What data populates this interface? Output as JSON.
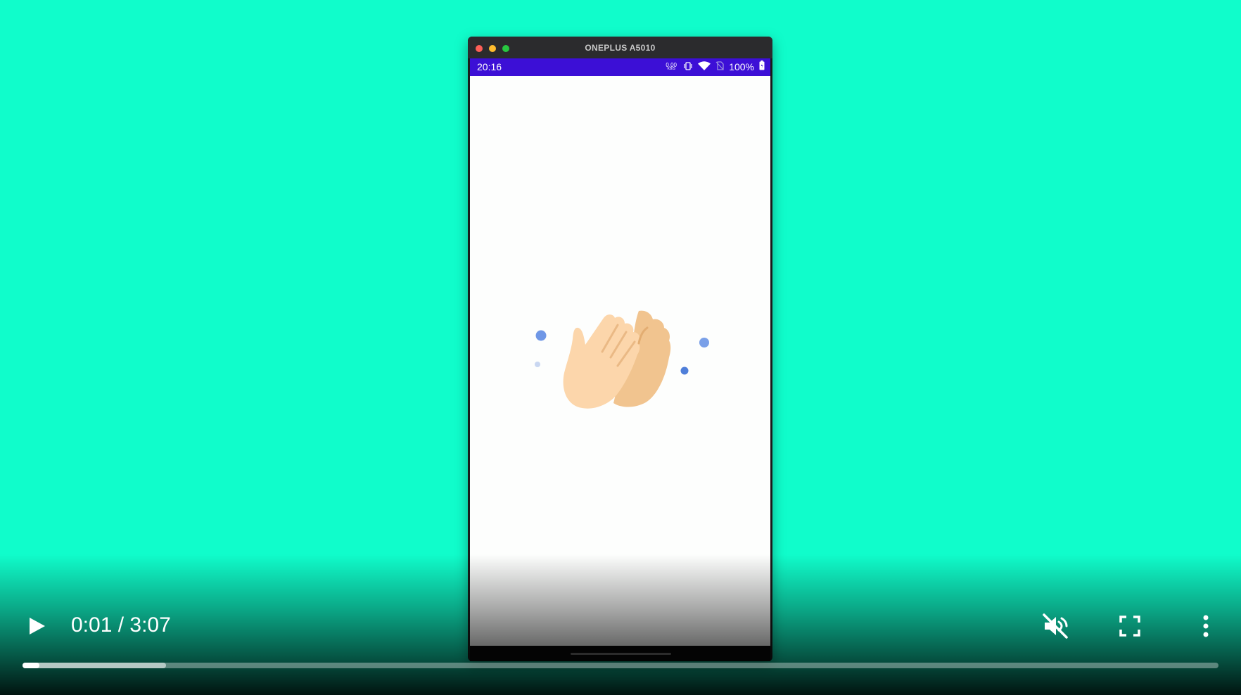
{
  "window": {
    "title": "ONEPLUS A5010"
  },
  "status_bar": {
    "time": "20:16",
    "net_speed_value": "0.00",
    "net_speed_unit": "KB/S",
    "battery": "100%",
    "icons": [
      "vibrate-icon",
      "wifi-icon",
      "no-sim-icon",
      "battery-icon"
    ]
  },
  "screen": {
    "illustration": "clapping-hands-icon",
    "background": "#fdfefd"
  },
  "video": {
    "time_display": "0:01 / 3:07",
    "played_fraction": 0.0133,
    "buffered_fraction": 0.12,
    "muted": true,
    "icons": [
      "play-icon",
      "muted-volume-icon",
      "fullscreen-icon",
      "more-vert-icon"
    ]
  },
  "colors": {
    "page_background": "#12ffcc",
    "status_bar": "#3c0fd6",
    "accent_dot": "#6f97e6"
  }
}
